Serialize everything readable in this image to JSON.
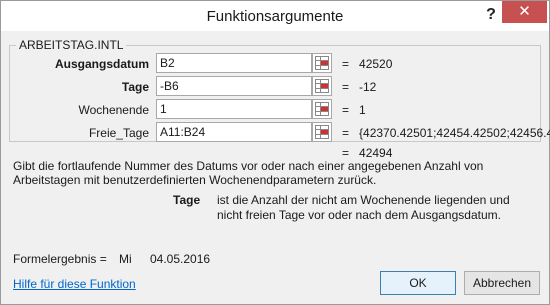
{
  "window": {
    "title": "Funktionsargumente",
    "help_glyph": "?",
    "close_glyph": "✕"
  },
  "function_name": "ARBEITSTAG.INTL",
  "args": [
    {
      "label": "Ausgangsdatum",
      "bold": true,
      "value": "B2",
      "eq": "=",
      "result": "42520"
    },
    {
      "label": "Tage",
      "bold": true,
      "value": "-B6",
      "eq": "=",
      "result": "-12"
    },
    {
      "label": "Wochenende",
      "bold": false,
      "value": "1",
      "eq": "=",
      "result": "1"
    },
    {
      "label": "Freie_Tage",
      "bold": false,
      "value": "A11:B24",
      "eq": "=",
      "result": "{42370.42501;42454.42502;42456.42..."
    }
  ],
  "total": {
    "eq": "=",
    "result": "42494"
  },
  "description": "Gibt die fortlaufende Nummer des Datums vor oder nach einer angegebenen Anzahl von Arbeitstagen mit benutzerdefinierten Wochenendparametern zurück.",
  "param": {
    "name": "Tage",
    "text": "ist die Anzahl der nicht am Wochenende liegenden und nicht freien Tage vor oder nach dem Ausgangsdatum."
  },
  "formula_result": {
    "label": "Formelergebnis =",
    "day": "Mi",
    "date": "04.05.2016"
  },
  "help_link": "Hilfe für diese Funktion",
  "buttons": {
    "ok": "OK",
    "cancel": "Abbrechen"
  },
  "colors": {
    "close_bg": "#c75050",
    "link": "#0066cc",
    "ref_icon_red": "#d03030"
  },
  "icons": {
    "ref": "range-select-icon"
  }
}
